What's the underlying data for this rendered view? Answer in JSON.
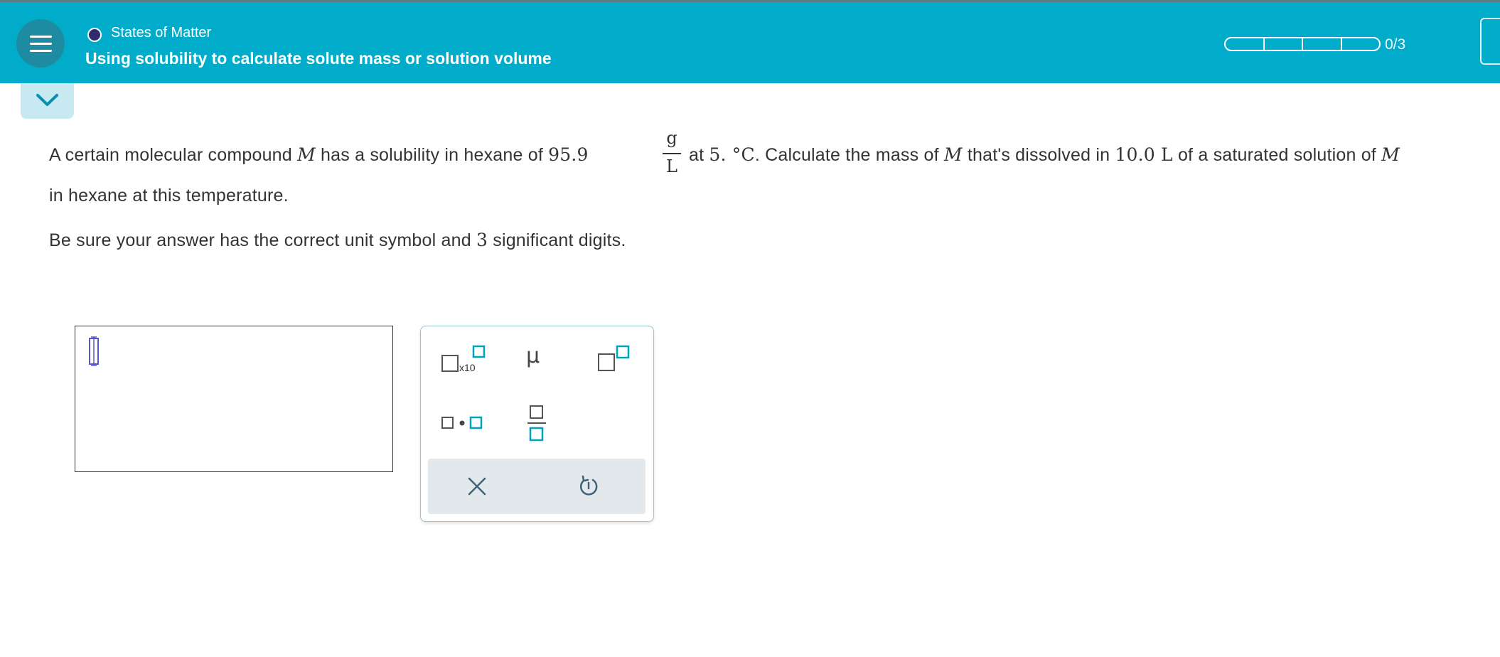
{
  "header": {
    "topic": "States of Matter",
    "title": "Using solubility to calculate solute mass or solution volume",
    "score": "0/3",
    "progress_filled_fraction": 0,
    "accent_color": "#00acc9"
  },
  "question": {
    "line1": {
      "t1": "A certain molecular compound",
      "var1": "M",
      "t2": "has a solubility in hexane of",
      "value": "95.9",
      "unit_num": "g",
      "unit_den": "L",
      "t3": "at",
      "temp": "5. °C",
      "t4": ". Calculate the mass of",
      "var2": "M",
      "t5": "that's dissolved in",
      "volume": "10.0 L",
      "t6": "of a saturated solution of",
      "var3": "M"
    },
    "line2": "in hexane at this temperature.",
    "instruction": {
      "pre": "Be sure your answer has the correct unit symbol and",
      "digits": "3",
      "post": "significant digits."
    }
  },
  "palette": {
    "sci_label": "x10",
    "micro": "μ",
    "icons": [
      "scientific-notation-icon",
      "micro-symbol",
      "superscript-icon",
      "multiply-dot-icon",
      "fraction-icon",
      "clear-icon",
      "undo-icon"
    ]
  }
}
